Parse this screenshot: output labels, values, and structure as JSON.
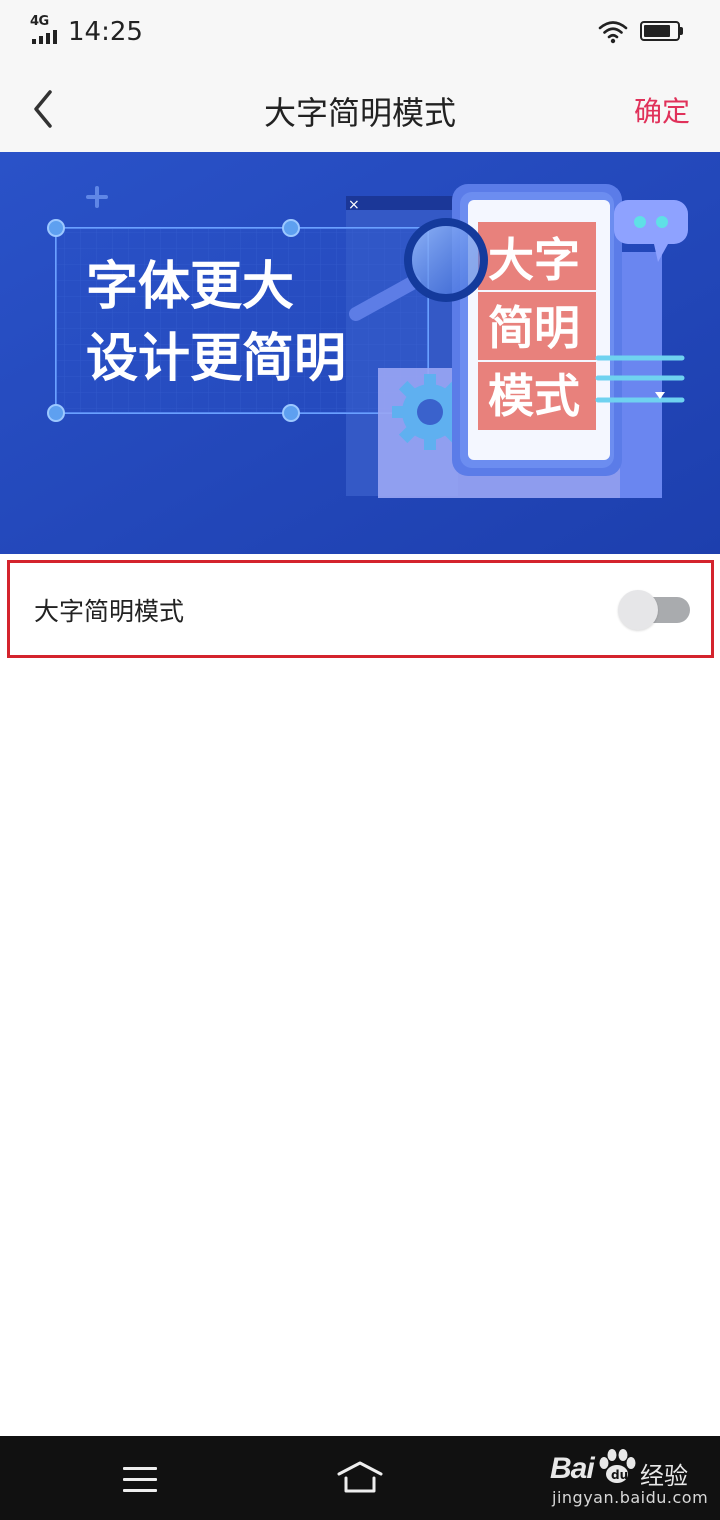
{
  "status_bar": {
    "network": "4G",
    "time": "14:25",
    "battery_level": 0.8,
    "icons": [
      "signal-icon",
      "wifi-icon",
      "battery-icon"
    ]
  },
  "header": {
    "back_icon": "chevron-left-icon",
    "title": "大字简明模式",
    "confirm_label": "确定"
  },
  "banner": {
    "headline_line1": "字体更大",
    "headline_line2": "设计更简明",
    "card_line1": "大字",
    "card_line2": "简明",
    "card_line3": "模式",
    "close_mark": "×"
  },
  "settings": {
    "large_simple_mode": {
      "label": "大字简明模式",
      "enabled": false
    }
  },
  "system_nav": {
    "icons": [
      "menu-icon",
      "home-icon"
    ]
  },
  "watermark": {
    "brand": "Bai",
    "cn": "经验",
    "url": "jingyan.baidu.com"
  },
  "colors": {
    "accent": "#e0315a",
    "banner_bg": "#2148b8",
    "highlight_border": "#d4232d",
    "toggle_off_track": "#a9abae"
  }
}
